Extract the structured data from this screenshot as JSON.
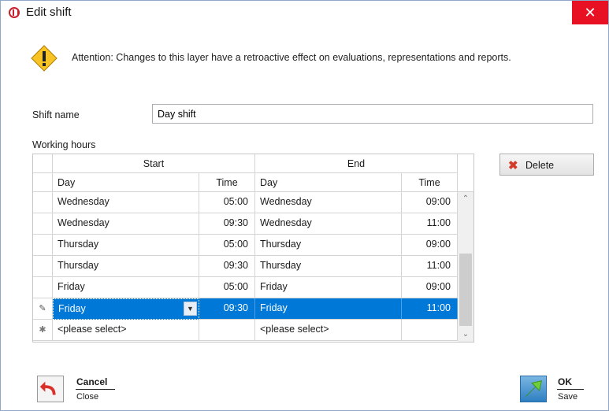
{
  "window": {
    "title": "Edit shift",
    "close_symbol": "✕"
  },
  "warning": {
    "icon": "warning-icon",
    "text": "Attention: Changes to this layer have a retroactive effect on evaluations, representations and reports."
  },
  "form": {
    "shift_name_label": "Shift name",
    "shift_name_value": "Day shift",
    "working_hours_label": "Working hours"
  },
  "grid": {
    "group_headers": {
      "start": "Start",
      "end": "End"
    },
    "columns": {
      "day": "Day",
      "time": "Time",
      "end_day": "Day",
      "end_time": "Time"
    },
    "rows": [
      {
        "start_day": "Wednesday",
        "start_time": "05:00",
        "end_day": "Wednesday",
        "end_time": "09:00"
      },
      {
        "start_day": "Wednesday",
        "start_time": "09:30",
        "end_day": "Wednesday",
        "end_time": "11:00"
      },
      {
        "start_day": "Thursday",
        "start_time": "05:00",
        "end_day": "Thursday",
        "end_time": "09:00"
      },
      {
        "start_day": "Thursday",
        "start_time": "09:30",
        "end_day": "Thursday",
        "end_time": "11:00"
      },
      {
        "start_day": "Friday",
        "start_time": "05:00",
        "end_day": "Friday",
        "end_time": "09:00"
      },
      {
        "start_day": "Friday",
        "start_time": "09:30",
        "end_day": "Friday",
        "end_time": "11:00"
      }
    ],
    "selected_row_index": 5,
    "new_row": {
      "start_day": "<please select>",
      "end_day": "<please select>"
    },
    "edit_indicator_icon": "pencil-icon",
    "new_row_indicator": "✱"
  },
  "buttons": {
    "delete": "Delete",
    "cancel_title": "Cancel",
    "cancel_sub": "Close",
    "ok_title": "OK",
    "ok_sub": "Save"
  },
  "colors": {
    "accent": "#0078d7",
    "close": "#e81123",
    "delete_icon": "#d23a2a"
  }
}
